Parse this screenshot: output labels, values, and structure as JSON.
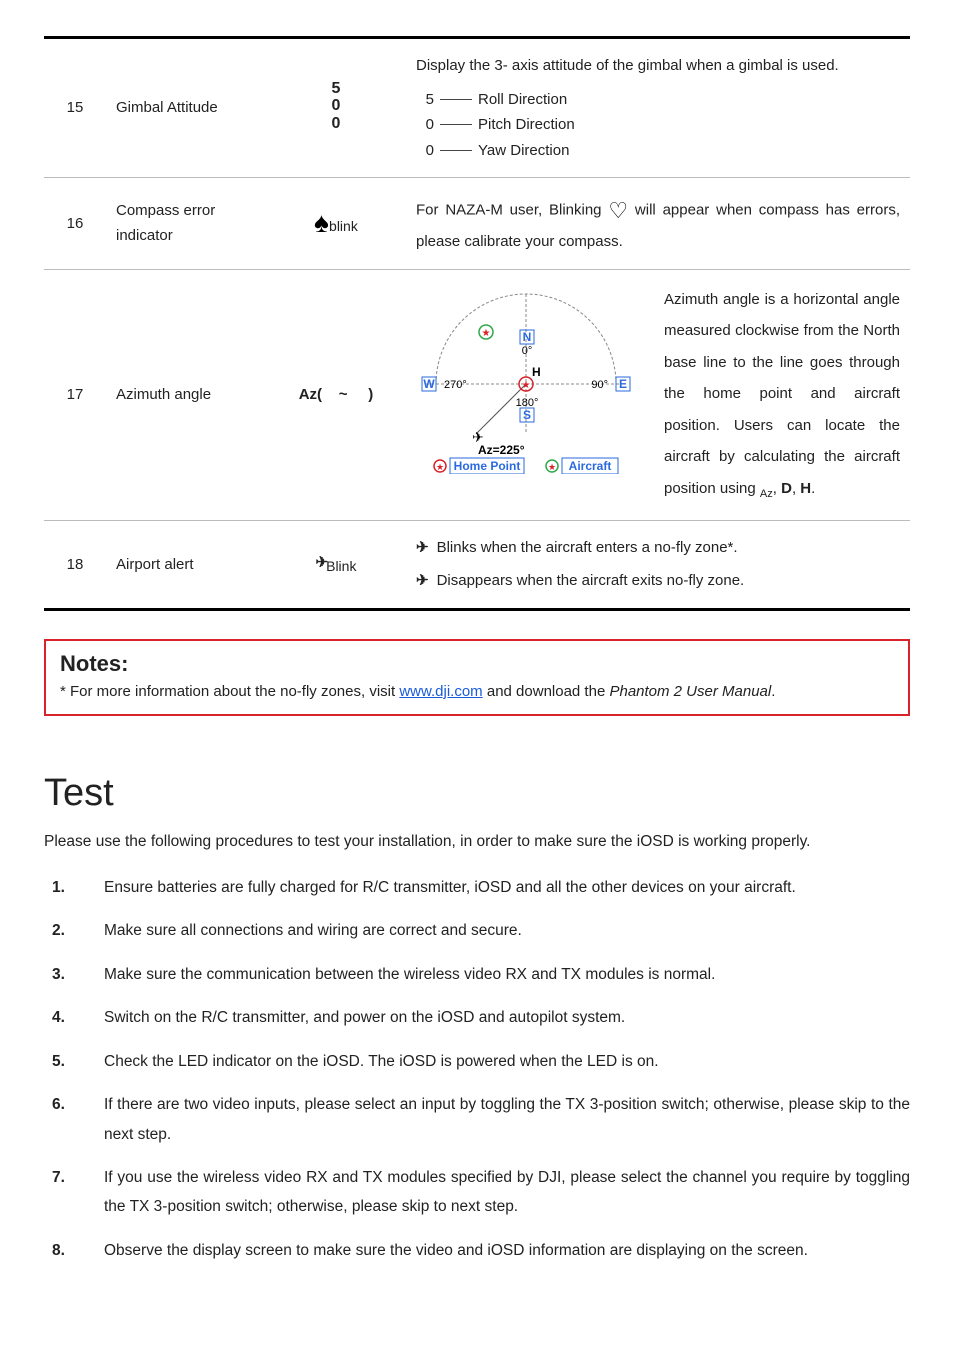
{
  "table": {
    "rows": [
      {
        "num": "15",
        "name": "Gimbal Attitude",
        "icon_vals": [
          "5",
          "0",
          "0"
        ],
        "desc_title": "Display the 3- axis attitude of the gimbal when a gimbal is used.",
        "axis_lines": [
          {
            "v": "5",
            "label": "Roll Direction"
          },
          {
            "v": "0",
            "label": "Pitch Direction"
          },
          {
            "v": "0",
            "label": "Yaw Direction"
          }
        ]
      },
      {
        "num": "16",
        "name": "Compass error indicator",
        "icon_suffix": "blink",
        "desc_line1a": "For NAZA-M user, Blinking",
        "desc_line1b": " will appear when compass has errors,",
        "desc_line2": "please calibrate your compass."
      },
      {
        "num": "17",
        "name": "Azimuth angle",
        "icon_label": "Az(    ~     )",
        "compass": {
          "n": "N",
          "s": "S",
          "e": "E",
          "w": "W",
          "d0": "0°",
          "d90": "90°",
          "d180": "180°",
          "d270": "270°",
          "az": "Az=225°",
          "h": "H",
          "legend_home": "Home Point",
          "legend_ac": "Aircraft"
        },
        "desc_text": "Azimuth angle is a horizontal angle measured clockwise from the North base line to the line goes through the home point and aircraft position. Users can locate the aircraft by calculating the aircraft position using",
        "formula_prefix": "Az",
        "formula_d": "D",
        "formula_h": "H"
      },
      {
        "num": "18",
        "name": "Airport alert",
        "icon_suffix": "Blink",
        "bullet1": "Blinks when the aircraft enters a no-fly zone*.",
        "bullet2": "Disappears when the aircraft exits no-fly zone."
      }
    ]
  },
  "notes": {
    "title": "Notes:",
    "text_pre": "* For more information about the no-fly zones, visit ",
    "link": "www.dji.com",
    "text_mid": " and download the ",
    "ital": "Phantom 2 User Manual",
    "text_post": "."
  },
  "test": {
    "heading": "Test",
    "intro": "Please use the following procedures to test your installation, in order to make sure the iOSD is working properly.",
    "steps": [
      "Ensure batteries are fully charged for R/C transmitter, iOSD and all the other devices on your aircraft.",
      "Make sure all connections and wiring are correct and secure.",
      "Make sure the communication between the wireless video RX and TX modules is normal.",
      "Switch on the R/C transmitter, and power on the iOSD and autopilot system.",
      "Check the LED indicator on the iOSD. The iOSD is powered when the LED is on.",
      "If there are two video inputs, please select an input by toggling the TX 3-position switch; otherwise, please skip to the next step.",
      "If you use the wireless video RX and TX modules specified by DJI, please select the channel you require by toggling the TX 3-position switch; otherwise, please skip to next step.",
      "Observe the display screen to make sure the video and iOSD information are displaying on the screen."
    ]
  }
}
